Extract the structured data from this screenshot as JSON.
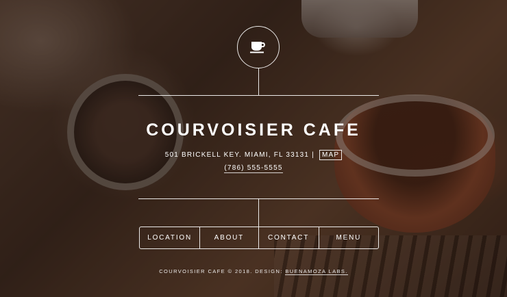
{
  "brand": {
    "icon": "coffee-cup-icon",
    "name": "COURVOISIER CAFE"
  },
  "contact": {
    "address": "501 BRICKELL KEY. MIAMI, FL 33131",
    "separator": "|",
    "map_label": "MAP",
    "phone": "(786) 555-5555"
  },
  "nav": {
    "items": [
      {
        "label": "LOCATION"
      },
      {
        "label": "ABOUT"
      },
      {
        "label": "CONTACT"
      },
      {
        "label": "MENU"
      }
    ]
  },
  "footer": {
    "text": "COURVOISIER CAFE © 2018. DESIGN:",
    "credit": "BUENAMOZA LABS."
  }
}
